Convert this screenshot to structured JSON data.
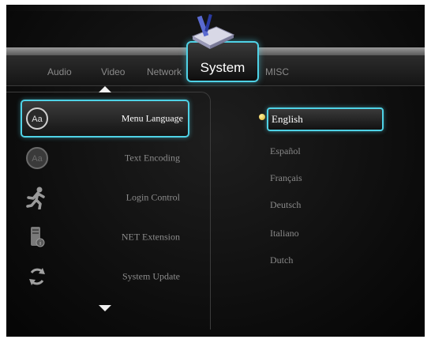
{
  "tabs": [
    {
      "label": "Audio"
    },
    {
      "label": "Video"
    },
    {
      "label": "Network"
    },
    {
      "label": "System"
    },
    {
      "label": "MISC"
    }
  ],
  "active_tab": "System",
  "menu": [
    {
      "label": "Menu Language",
      "icon": "aa-text-icon"
    },
    {
      "label": "Text Encoding",
      "icon": "aa-text-icon"
    },
    {
      "label": "Login Control",
      "icon": "running-man-icon"
    },
    {
      "label": "NET Extension",
      "icon": "storage-device-icon"
    },
    {
      "label": "System Update",
      "icon": "refresh-icon"
    }
  ],
  "selected_menu": "Menu Language",
  "languages": [
    "English",
    "Español",
    "Français",
    "Deutsch",
    "Italiano",
    "Dutch"
  ],
  "selected_language": "English",
  "colors": {
    "highlight": "#4fd2e6",
    "background": "#0c0c0c",
    "text_dim": "#8a8a8a",
    "text_bright": "#ffffff",
    "bullet": "#e0b020"
  }
}
